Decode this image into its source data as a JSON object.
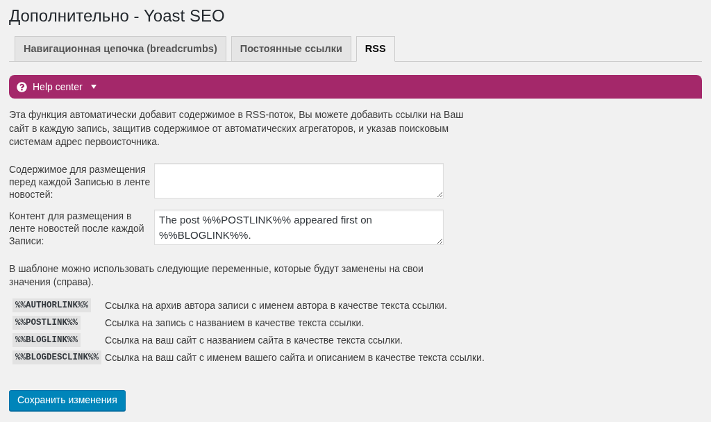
{
  "page_title": "Дополнительно - Yoast SEO",
  "tabs": [
    {
      "label": "Навигационная цепочка (breadcrumbs)",
      "selected": false
    },
    {
      "label": "Постоянные ссылки",
      "selected": false
    },
    {
      "label": "RSS",
      "selected": true
    }
  ],
  "help_center": {
    "label": "Help center"
  },
  "intro": "Эта функция автоматически добавит содержимое в RSS-поток, Вы можете добавить ссылки на Ваш сайт в каждую запись, защитив содержимое от автоматических агрегаторов, и указав поисковым системам адрес первоисточника.",
  "fields": [
    {
      "label": "Содержимое для размещения перед каждой Записью в ленте новостей:"
    },
    {
      "label": "Контент для размещения в ленте новостей после каждой Записи:",
      "value": "The post %%POSTLINK%% appeared first on %%BLOGLINK%%."
    }
  ],
  "variables_intro": "В шаблоне можно использовать следующие переменные, которые будут заменены на свои значения (справа).",
  "variables": [
    {
      "name": "%%AUTHORLINK%%",
      "description": "Ссылка на архив автора записи с именем автора в качестве текста ссылки."
    },
    {
      "name": "%%POSTLINK%%",
      "description": "Ссылка на запись с названием в качестве текста ссылки."
    },
    {
      "name": "%%BLOGLINK%%",
      "description": "Ссылка на ваш сайт с названием сайта в качестве текста ссылки."
    },
    {
      "name": "%%BLOGDESCLINK%%",
      "description": "Ссылка на ваш сайт с именем вашего сайта и описанием в качестве текста ссылки."
    }
  ],
  "save_button": "Сохранить изменения"
}
